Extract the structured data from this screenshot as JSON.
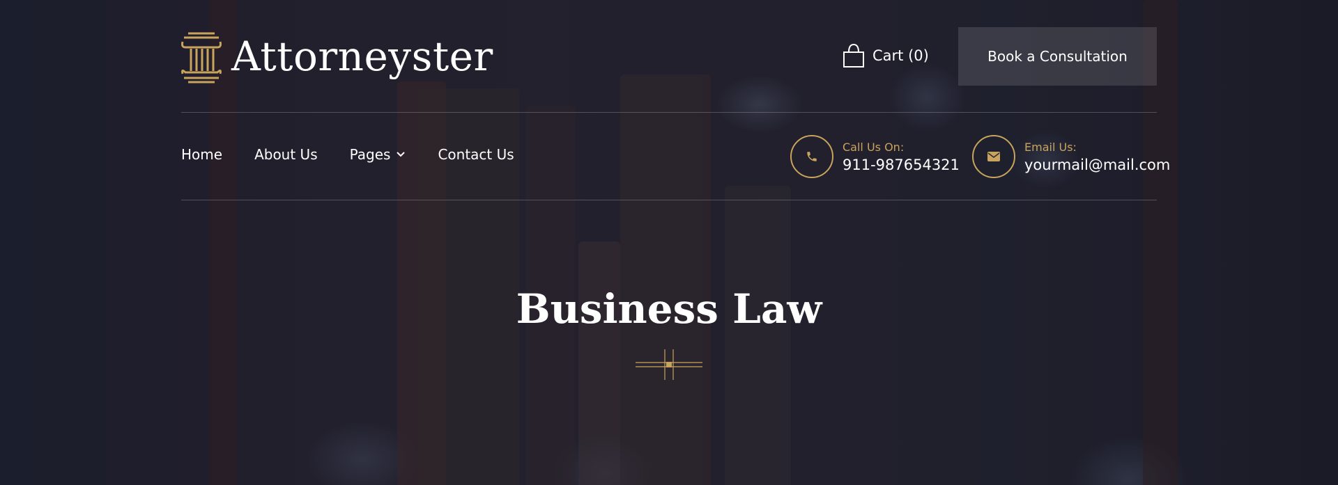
{
  "brand": {
    "name": "Attorneyster"
  },
  "header": {
    "cart_label": "Cart (0)",
    "cta_label": "Book a Consultation"
  },
  "nav": {
    "items": [
      "Home",
      "About Us",
      "Pages",
      "Contact Us"
    ]
  },
  "contacts": {
    "phone": {
      "label": "Call Us On:",
      "value": "911-987654321"
    },
    "email": {
      "label": "Email Us:",
      "value": "yourmail@mail.com"
    }
  },
  "page": {
    "title": "Business Law"
  },
  "colors": {
    "accent": "#c9a45c",
    "background": "#1d2130"
  },
  "icons": [
    "pillar-logo-icon",
    "shopping-bag-icon",
    "chevron-down-icon",
    "phone-icon",
    "envelope-icon",
    "ornament-divider-icon"
  ]
}
